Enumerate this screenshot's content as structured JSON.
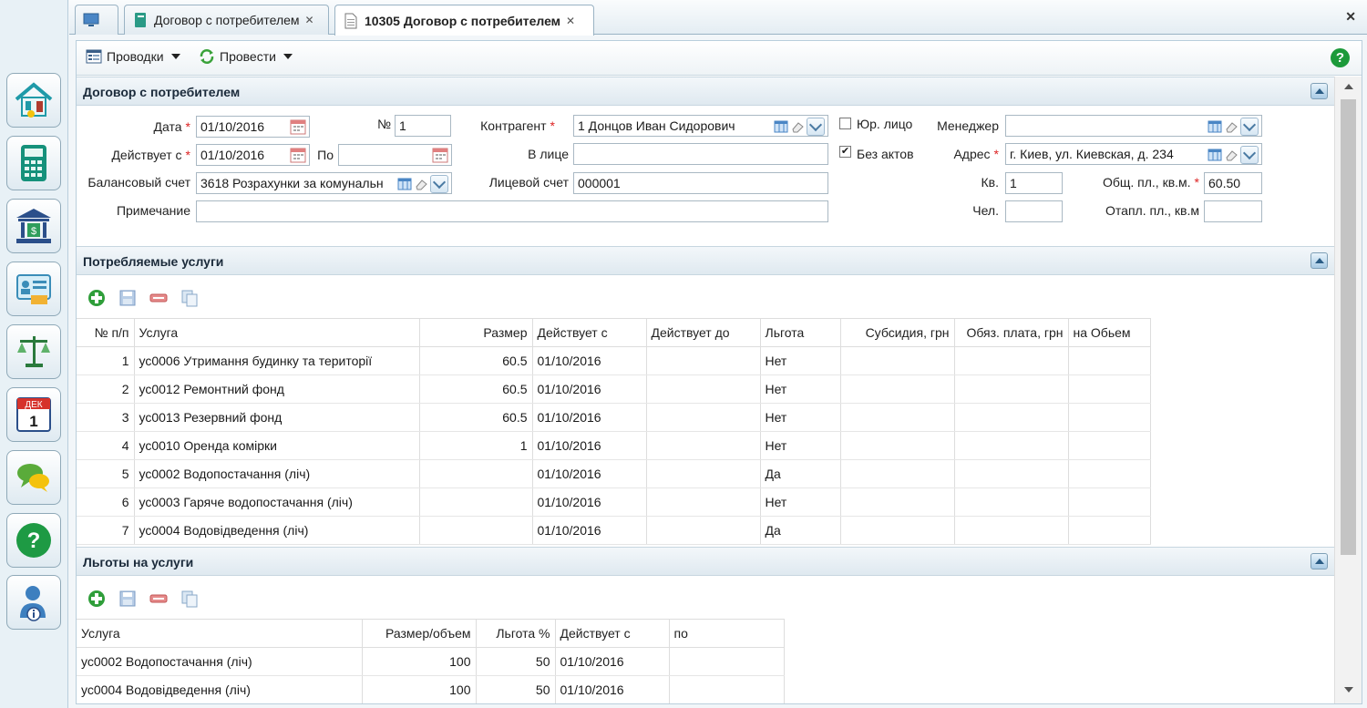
{
  "tabs": [
    {
      "label": ""
    },
    {
      "label": "Договор с потребителем"
    },
    {
      "label": "10305 Договор с потребителем"
    }
  ],
  "close_glyph": "✕",
  "toolbar": {
    "postings_label": "Проводки",
    "post_label": "Провести",
    "help": "?"
  },
  "contract": {
    "title": "Договор с потребителем",
    "date_label": "Дата",
    "date": "01/10/2016",
    "number_label": "№",
    "number": "1",
    "valid_from_label": "Действует с",
    "valid_from": "01/10/2016",
    "valid_to_label": "По",
    "valid_to": "",
    "balance_account_label": "Балансовый счет",
    "balance_account": "3618 Розрахунки за комунальн",
    "note_label": "Примечание",
    "note": "",
    "counterparty_label": "Контрагент",
    "counterparty": "1 Донцов Иван Сидорович",
    "represented_by_label": "В лице",
    "represented_by": "",
    "personal_account_label": "Лицевой счет",
    "personal_account": "000001",
    "legal_entity_label": "Юр. лицо",
    "legal_entity_checked": false,
    "no_acts_label": "Без актов",
    "no_acts_checked": true,
    "manager_label": "Менеджер",
    "manager": "",
    "address_label": "Адрес",
    "address": "г. Киев, ул. Киевская, д. 234",
    "apt_label": "Кв.",
    "apt": "1",
    "total_area_label": "Общ. пл., кв.м.",
    "total_area": "60.50",
    "people_label": "Чел.",
    "people": "",
    "heated_area_label": "Отапл. пл., кв.м",
    "heated_area": "",
    "required_mark": "*"
  },
  "services": {
    "title": "Потребляемые услуги",
    "columns": [
      "№ п/п",
      "Услуга",
      "Размер",
      "Действует с",
      "Действует до",
      "Льгота",
      "Субсидия, грн",
      "Обяз. плата, грн",
      "на Обьем"
    ],
    "rows": [
      [
        "1",
        "ус0006 Утримання будинку та території",
        "60.5",
        "01/10/2016",
        "",
        "Нет",
        "",
        "",
        ""
      ],
      [
        "2",
        "ус0012 Ремонтний фонд",
        "60.5",
        "01/10/2016",
        "",
        "Нет",
        "",
        "",
        ""
      ],
      [
        "3",
        "ус0013 Резервний фонд",
        "60.5",
        "01/10/2016",
        "",
        "Нет",
        "",
        "",
        ""
      ],
      [
        "4",
        "ус0010 Оренда комірки",
        "1",
        "01/10/2016",
        "",
        "Нет",
        "",
        "",
        ""
      ],
      [
        "5",
        "ус0002 Водопостачання (ліч)",
        "",
        "01/10/2016",
        "",
        "Да",
        "",
        "",
        ""
      ],
      [
        "6",
        "ус0003 Гаряче водопостачання (ліч)",
        "",
        "01/10/2016",
        "",
        "Нет",
        "",
        "",
        ""
      ],
      [
        "7",
        "ус0004 Водовідведення (ліч)",
        "",
        "01/10/2016",
        "",
        "Да",
        "",
        "",
        ""
      ]
    ]
  },
  "benefits": {
    "title": "Льготы на услуги",
    "columns": [
      "Услуга",
      "Размер/объем",
      "Льгота %",
      "Действует с",
      "по"
    ],
    "rows": [
      [
        "ус0002 Водопостачання (ліч)",
        "100",
        "50",
        "01/10/2016",
        ""
      ],
      [
        "ус0004 Водовідведення (ліч)",
        "100",
        "50",
        "01/10/2016",
        ""
      ]
    ]
  },
  "rail": {
    "calendar_month": "ДЕК",
    "calendar_day": "1"
  }
}
